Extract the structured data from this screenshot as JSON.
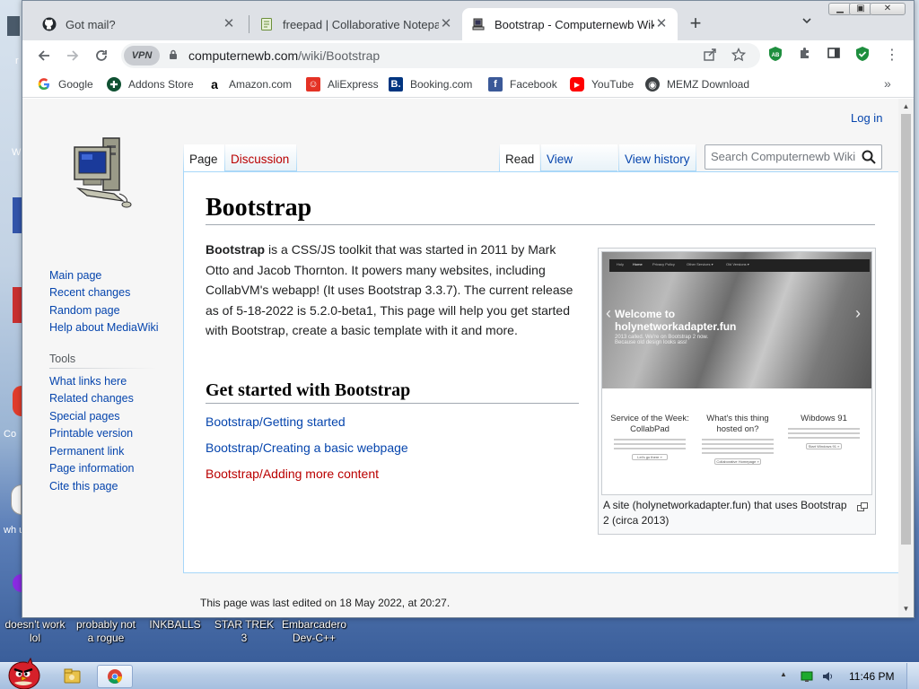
{
  "browser": {
    "tabs": [
      {
        "title": "Got mail?",
        "icon": "github-icon"
      },
      {
        "title": "freepad | Collaborative Notepad",
        "icon": "notepad-icon"
      },
      {
        "title": "Bootstrap - Computernewb Wiki",
        "icon": "wiki-icon",
        "active": true
      }
    ],
    "new_tab": "+",
    "vpn_label": "VPN",
    "url_domain": "computernewb.com",
    "url_path": "/wiki/Bootstrap",
    "bookmarks": [
      {
        "label": "Google",
        "icon": "google-icon"
      },
      {
        "label": "Addons Store",
        "icon": "addons-icon"
      },
      {
        "label": "Amazon.com",
        "icon": "amazon-icon"
      },
      {
        "label": "AliExpress",
        "icon": "aliexpress-icon"
      },
      {
        "label": "Booking.com",
        "icon": "booking-icon"
      },
      {
        "label": "Facebook",
        "icon": "facebook-icon"
      },
      {
        "label": "YouTube",
        "icon": "youtube-icon"
      },
      {
        "label": "MEMZ Download",
        "icon": "memz-icon"
      }
    ],
    "bookmarks_more": "»"
  },
  "wiki": {
    "login": "Log in",
    "sidebar_nav": [
      "Main page",
      "Recent changes",
      "Random page",
      "Help about MediaWiki"
    ],
    "tools_heading": "Tools",
    "tools": [
      "What links here",
      "Related changes",
      "Special pages",
      "Printable version",
      "Permanent link",
      "Page information",
      "Cite this page"
    ],
    "tabs_left": [
      "Page",
      "Discussion"
    ],
    "tabs_right": [
      "Read",
      "View source",
      "View history"
    ],
    "search_placeholder": "Search Computernewb Wiki",
    "title": "Bootstrap",
    "intro_bold": "Bootstrap",
    "intro_rest": " is a CSS/JS toolkit that was started in 2011 by Mark Otto and Jacob Thornton. It powers many websites, including CollabVM's webapp! (It uses Bootstrap 3.3.7). The current release as of 5-18-2022 is 5.2.0-beta1, This page will help you get started with Bootstrap, create a basic template with it and more.",
    "section_heading": "Get started with Bootstrap",
    "subpages": [
      {
        "label": "Bootstrap/Getting started",
        "exists": true
      },
      {
        "label": "Bootstrap/Creating a basic webpage",
        "exists": true
      },
      {
        "label": "Bootstrap/Adding more content",
        "exists": false
      }
    ],
    "thumb_caption": "A site (holynetworkadapter.fun) that uses Bootstrap 2 (circa 2013)",
    "thumb": {
      "nav": [
        "Holy",
        "Home",
        "Privacy Policy",
        "Other Services ▾",
        "Old Versions ▾"
      ],
      "hero_title": "Welcome to holynetworkadapter.fun",
      "hero_sub": "2013 called. We're on Bootstrap 2 now. Because old design looks ass!",
      "features": [
        {
          "title": "Service of the Week: CollabPad",
          "button": "Let's go there »"
        },
        {
          "title": "What's this thing hosted on?",
          "button": "Collaborative Homepage »"
        },
        {
          "title": "Wibdows 91",
          "button": "Start Windows 91 »"
        }
      ]
    },
    "footer": "This page was last edited on 18 May 2022, at 20:27."
  },
  "desktop": {
    "icons": [
      "doesn't work lol",
      "probably not a rogue",
      "INKBALLS",
      "STAR TREK 3",
      "Embarcadero Dev-C++"
    ],
    "peek_labels": [
      "r",
      "W",
      "Co",
      "wh u"
    ]
  },
  "taskbar": {
    "clock": "11:46 PM"
  },
  "colors": {
    "link": "#0645ad",
    "redlink": "#ba0000",
    "accent_green": "#1e8e3e"
  }
}
